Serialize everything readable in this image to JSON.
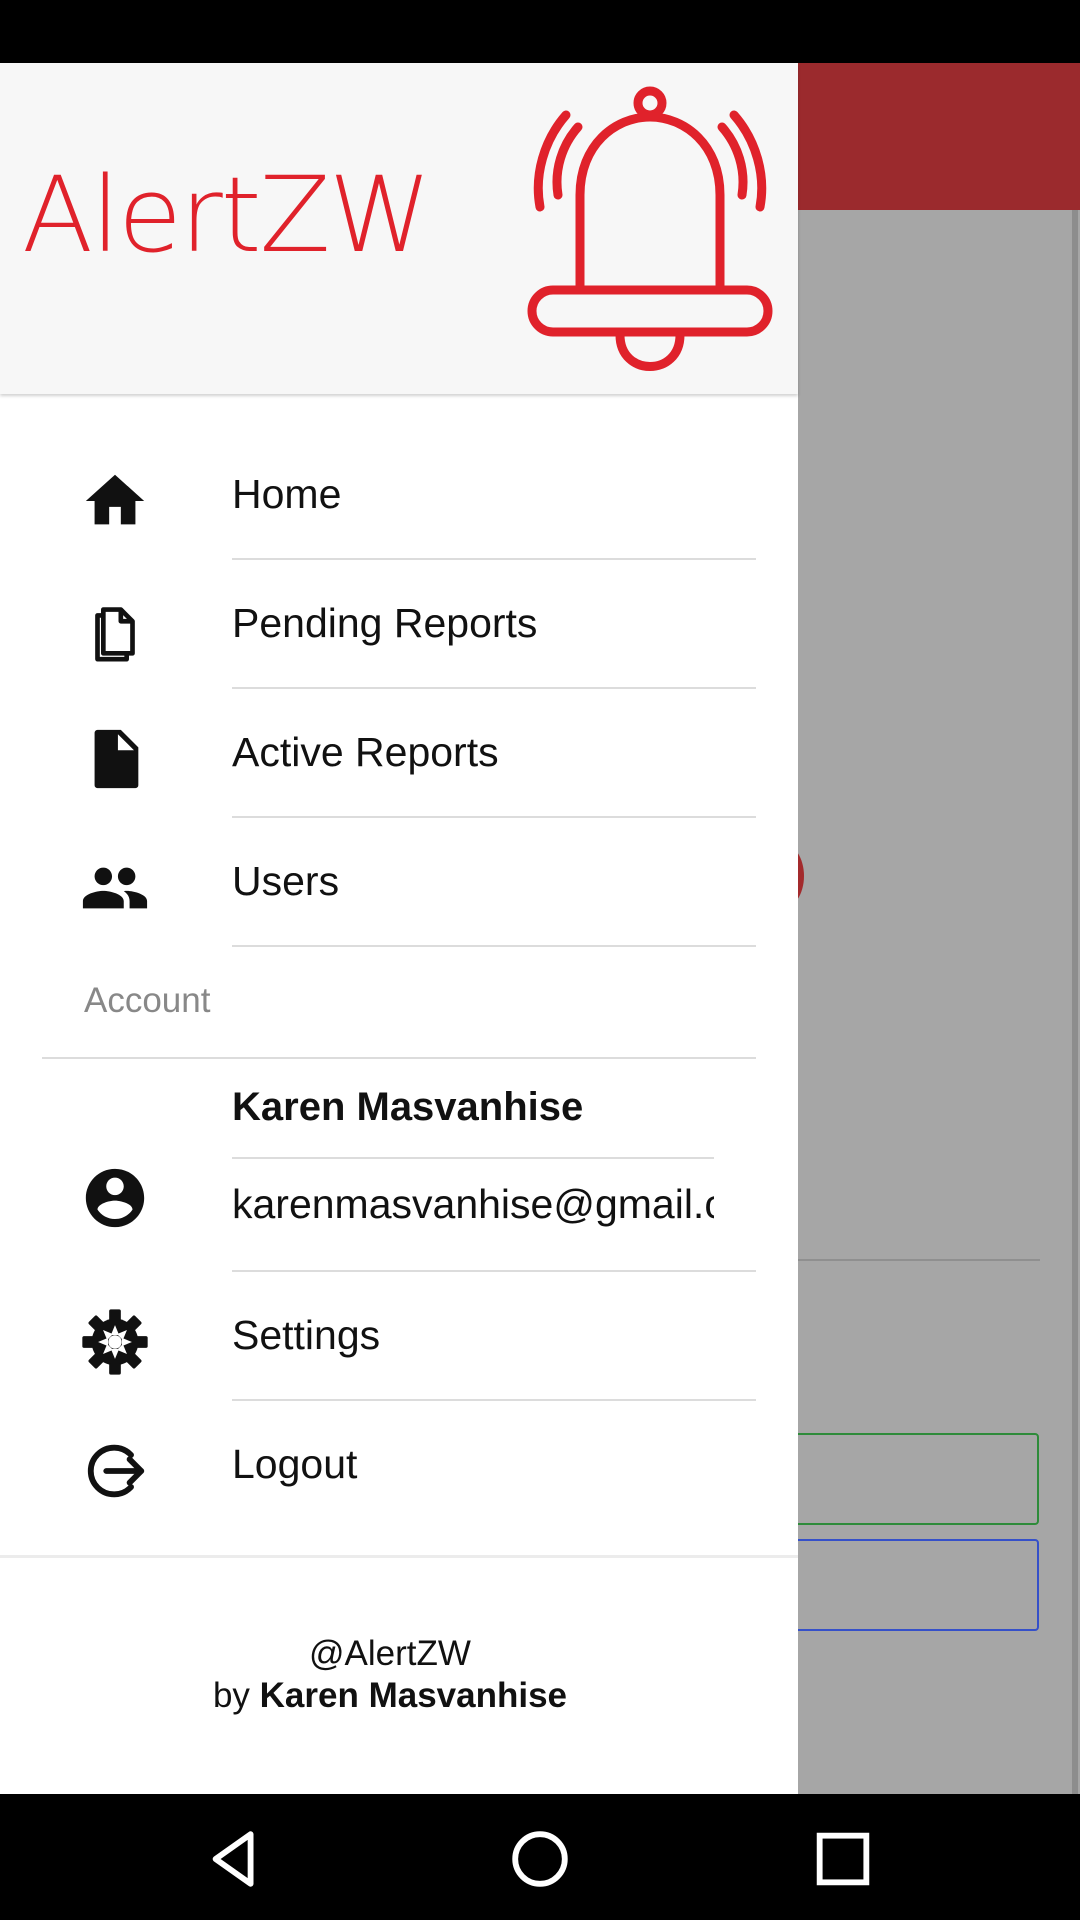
{
  "app": {
    "brand_name": "AlertZW",
    "accent_color": "#e0222b",
    "app_bar_color": "#9b2a2d"
  },
  "drawer": {
    "menu": [
      {
        "label": "Home",
        "icon": "home-icon"
      },
      {
        "label": "Pending Reports",
        "icon": "copy-documents-icon"
      },
      {
        "label": "Active Reports",
        "icon": "document-icon"
      },
      {
        "label": "Users",
        "icon": "people-icon"
      }
    ],
    "section_title": "Account",
    "account": {
      "name": "Karen Masvanhise",
      "email": "karenmasvanhise@gmail.com",
      "icon": "account-circle-icon"
    },
    "settings_label": "Settings",
    "logout_label": "Logout",
    "footer": {
      "handle": "@AlertZW",
      "by_prefix": "by",
      "author": "Karen Masvanhise"
    }
  },
  "navbar": {
    "buttons": [
      "back-icon",
      "home-circle-icon",
      "recents-icon"
    ]
  }
}
